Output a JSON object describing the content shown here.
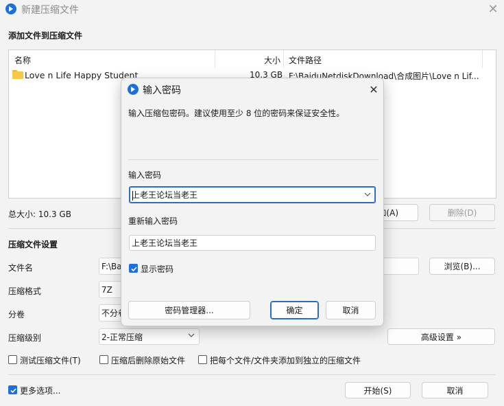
{
  "window": {
    "title": "新建压缩文件",
    "close_glyph": "✕"
  },
  "add_section": {
    "label": "添加文件到压缩文件",
    "columns": {
      "name": "名称",
      "size": "大小",
      "path": "文件路径"
    },
    "rows": [
      {
        "name": "Love n Life Happy Student",
        "size": "10.3 GB",
        "path": "F:\\BaiduNetdiskDownload\\合成图片\\Love n Lif..."
      }
    ],
    "total_size": "总大小: 10.3 GB",
    "add_button": "加(A)",
    "delete_button": "删除(D)"
  },
  "settings": {
    "label": "压缩文件设置",
    "filename_label": "文件名",
    "filename_value": "F:\\Ba",
    "browse_button": "浏览(B)...",
    "format_label": "压缩格式",
    "format_value": "7Z",
    "volume_label": "分卷",
    "volume_value": "不分卷",
    "level_label": "压缩级别",
    "level_value": "2-正常压缩",
    "advanced_button": "高级设置 »",
    "test_checkbox": "测试压缩文件(T)",
    "delete_source_checkbox": "压缩后删除原始文件",
    "separate_checkbox": "把每个文件/文件夹添加到独立的压缩文件"
  },
  "footer": {
    "more_options": "更多选项...",
    "start_button": "开始(S)",
    "cancel_button": "取消"
  },
  "dialog": {
    "title": "输入密码",
    "close_glyph": "✕",
    "description": "输入压缩包密码。建议使用至少 8 位的密码来保证安全性。",
    "password_label": "输入密码",
    "password_value": "上老王论坛当老王",
    "confirm_label": "重新输入密码",
    "confirm_value": "上老王论坛当老王",
    "show_password": "显示密码",
    "manager_button": "密码管理器...",
    "ok_button": "确定",
    "cancel_button": "取消"
  },
  "colors": {
    "accent": "#1e6fd9",
    "window_bg": "#f3f3f3",
    "folder": "#f6c84a"
  },
  "icons": [
    "app-logo-icon",
    "close-icon",
    "folder-icon",
    "chevron-down-icon",
    "checkmark-icon"
  ]
}
